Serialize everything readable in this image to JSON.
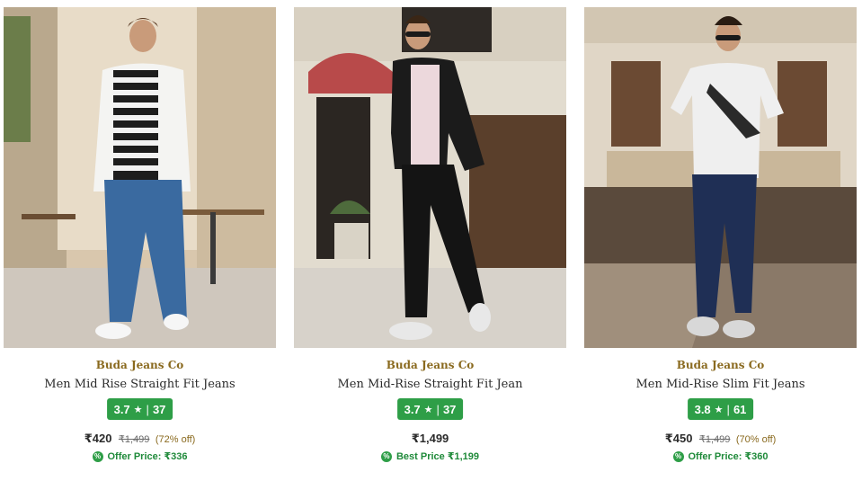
{
  "products": [
    {
      "brand": "Buda Jeans Co",
      "title": "Men Mid Rise Straight Fit Jeans",
      "rating": "3.7",
      "reviews": "37",
      "price": "₹420",
      "mrp": "₹1,499",
      "discount": "(72% off)",
      "offer": "Offer Price: ₹336"
    },
    {
      "brand": "Buda Jeans Co",
      "title": "Men Mid-Rise Straight Fit Jean",
      "rating": "3.7",
      "reviews": "37",
      "price": "₹1,499",
      "mrp": "",
      "discount": "",
      "offer": "Best Price ₹1,199"
    },
    {
      "brand": "Buda Jeans Co",
      "title": "Men Mid-Rise Slim Fit Jeans",
      "rating": "3.8",
      "reviews": "61",
      "price": "₹450",
      "mrp": "₹1,499",
      "discount": "(70% off)",
      "offer": "Offer Price: ₹360"
    }
  ],
  "ui": {
    "star": "★",
    "separator": "|",
    "offer_symbol": "%"
  },
  "colors": {
    "brand": "#8a6a1f",
    "rating_badge": "#2e9e47",
    "offer_text": "#1f8a3a"
  },
  "icons": {
    "rating": "star-icon",
    "offer": "offer-tag-icon"
  }
}
